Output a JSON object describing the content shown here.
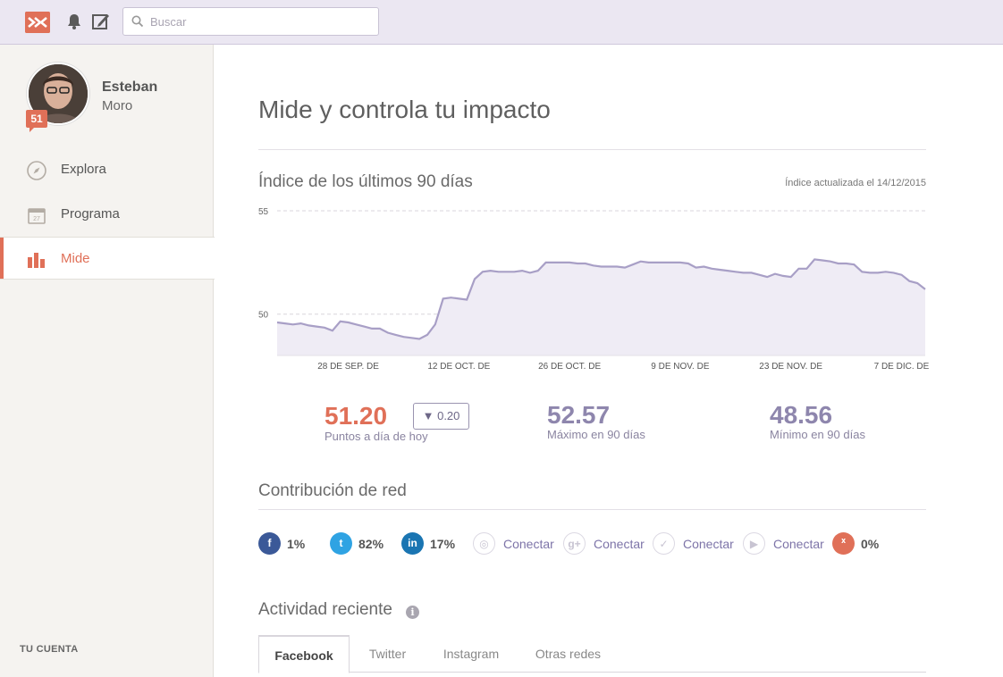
{
  "header": {
    "logo_text": "ᕁ",
    "search_placeholder": "Buscar"
  },
  "sidebar": {
    "user": {
      "first_name": "Esteban",
      "last_name": "Moro",
      "score": "51"
    },
    "items": [
      {
        "label": "Explora",
        "icon": "compass-icon"
      },
      {
        "label": "Programa",
        "icon": "calendar-icon"
      },
      {
        "label": "Mide",
        "icon": "bar-chart-icon",
        "active": true
      }
    ],
    "account_heading": "TU CUENTA"
  },
  "main": {
    "title": "Mide y controla tu impacto",
    "index": {
      "title": "Índice de los últimos 90 días",
      "updated": "Índice actualizada el 14/12/2015"
    },
    "stats": {
      "current_value": "51.20",
      "current_label": "Puntos a día de hoy",
      "delta": "▼ 0.20",
      "max_value": "52.57",
      "max_label": "Máximo en 90 días",
      "min_value": "48.56",
      "min_label": "Mínimo en 90 días"
    },
    "network": {
      "title": "Contribución de red",
      "items": [
        {
          "icon": "facebook-icon",
          "glyph": "f",
          "value": "1%",
          "color": "#3b5998"
        },
        {
          "icon": "twitter-icon",
          "glyph": "t",
          "value": "82%",
          "color": "#2fa3e3"
        },
        {
          "icon": "linkedin-icon",
          "glyph": "in",
          "value": "17%",
          "color": "#1a75b2"
        },
        {
          "icon": "instagram-icon",
          "glyph": "◎",
          "link": "Conectar"
        },
        {
          "icon": "google-plus-icon",
          "glyph": "g+",
          "link": "Conectar"
        },
        {
          "icon": "foursquare-icon",
          "glyph": "✓",
          "link": "Conectar"
        },
        {
          "icon": "youtube-icon",
          "glyph": "▶",
          "link": "Conectar"
        },
        {
          "icon": "klout-icon",
          "glyph": "ᕁ",
          "value": "0%",
          "color": "#e07058"
        }
      ]
    },
    "activity": {
      "title": "Actividad reciente",
      "tabs": [
        "Facebook",
        "Twitter",
        "Instagram",
        "Otras redes"
      ]
    }
  },
  "chart_data": {
    "type": "area",
    "title": "Índice de los últimos 90 días",
    "ylim": [
      48,
      55
    ],
    "yticks": [
      50,
      55
    ],
    "grid": true,
    "x_tick_labels": [
      "28 DE SEP. DE",
      "12 DE OCT. DE",
      "26 DE OCT. DE",
      "9 DE NOV. DE",
      "23 DE NOV. DE",
      "7 DE DIC. DE"
    ],
    "x_tick_index": [
      9,
      23,
      37,
      51,
      65,
      79
    ],
    "color": "#a89fc6",
    "fill": "#efecf5",
    "values": [
      49.6,
      49.55,
      49.5,
      49.55,
      49.45,
      49.4,
      49.35,
      49.2,
      49.65,
      49.6,
      49.5,
      49.4,
      49.3,
      49.3,
      49.1,
      49.0,
      48.9,
      48.85,
      48.8,
      49.0,
      49.5,
      50.75,
      50.8,
      50.75,
      50.7,
      51.7,
      52.05,
      52.1,
      52.05,
      52.05,
      52.05,
      52.1,
      52.0,
      52.1,
      52.5,
      52.5,
      52.5,
      52.5,
      52.45,
      52.45,
      52.35,
      52.3,
      52.3,
      52.3,
      52.25,
      52.4,
      52.55,
      52.5,
      52.5,
      52.5,
      52.5,
      52.5,
      52.45,
      52.25,
      52.3,
      52.2,
      52.15,
      52.1,
      52.05,
      52.0,
      52.0,
      51.9,
      51.8,
      51.95,
      51.85,
      51.8,
      52.2,
      52.2,
      52.65,
      52.6,
      52.55,
      52.45,
      52.45,
      52.4,
      52.05,
      52.0,
      52.0,
      52.05,
      52.0,
      51.9,
      51.6,
      51.5,
      51.2
    ]
  }
}
